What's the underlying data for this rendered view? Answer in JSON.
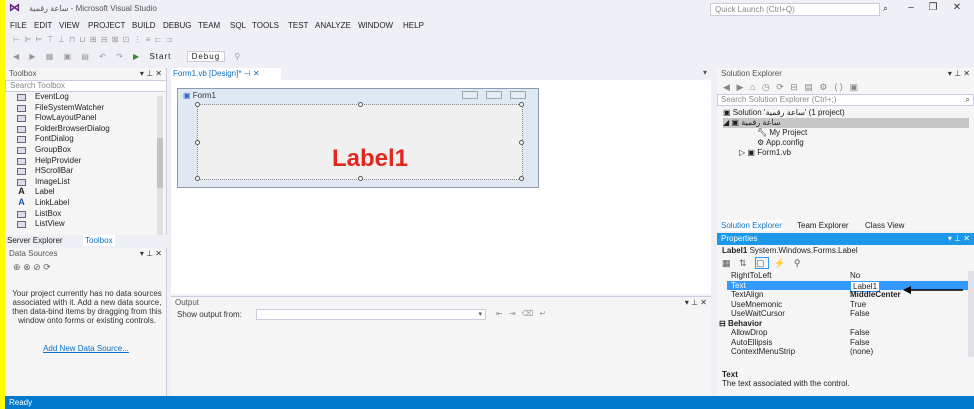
{
  "window": {
    "title": "ساعة رقمية - Microsoft Visual Studio",
    "quick_launch": "Quick Launch (Ctrl+Q)"
  },
  "menu": [
    "FILE",
    "EDIT",
    "VIEW",
    "PROJECT",
    "BUILD",
    "DEBUG",
    "TEAM",
    "SQL",
    "TOOLS",
    "TEST",
    "ANALYZE",
    "WINDOW",
    "HELP"
  ],
  "toolbar": {
    "start_label": "Start",
    "config": "Debug"
  },
  "toolbox": {
    "title": "Toolbox",
    "search_placeholder": "Search Toolbox",
    "items": [
      "EventLog",
      "FileSystemWatcher",
      "FlowLayoutPanel",
      "FolderBrowserDialog",
      "FontDialog",
      "GroupBox",
      "HelpProvider",
      "HScrollBar",
      "ImageList",
      "Label",
      "LinkLabel",
      "ListBox",
      "ListView"
    ],
    "tab_server_explorer": "Server Explorer",
    "tab_toolbox": "Toolbox"
  },
  "data_sources": {
    "title": "Data Sources",
    "message": "Your project currently has no data sources associated with it. Add a new data source, then data-bind items by dragging from this window onto forms or existing controls.",
    "link": "Add New Data Source..."
  },
  "designer": {
    "tab_label": "Form1.vb [Design]*",
    "form_title": "Form1",
    "label_text": "Label1"
  },
  "output": {
    "title": "Output",
    "show_from": "Show output from:"
  },
  "solution_explorer": {
    "title": "Solution Explorer",
    "search_placeholder": "Search Solution Explorer (Ctrl+;)",
    "solution": "Solution 'ساعة رقمية' (1 project)",
    "project": "ساعة رقمية",
    "my_project": "My Project",
    "app_config": "App.config",
    "form1": "Form1.vb",
    "tabs": [
      "Solution Explorer",
      "Team Explorer",
      "Class View"
    ]
  },
  "properties": {
    "title": "Properties",
    "object": "Label1",
    "object_type": "System.Windows.Forms.Label",
    "rows": [
      {
        "name": "RightToLeft",
        "value": "No"
      },
      {
        "name": "Text",
        "value": "Label1"
      },
      {
        "name": "TextAlign",
        "value": "MiddleCenter"
      },
      {
        "name": "UseMnemonic",
        "value": "True"
      },
      {
        "name": "UseWaitCursor",
        "value": "False"
      },
      {
        "name": "Behavior",
        "value": ""
      },
      {
        "name": "AllowDrop",
        "value": "False"
      },
      {
        "name": "AutoEllipsis",
        "value": "False"
      },
      {
        "name": "ContextMenuStrip",
        "value": "(none)"
      }
    ],
    "desc_title": "Text",
    "desc_text": "The text associated with the control."
  },
  "status": "Ready",
  "colors": {
    "accent": "#007acc",
    "label_red": "#e0281e",
    "props_header": "#1c97ea",
    "highlight": "#ffff00"
  }
}
